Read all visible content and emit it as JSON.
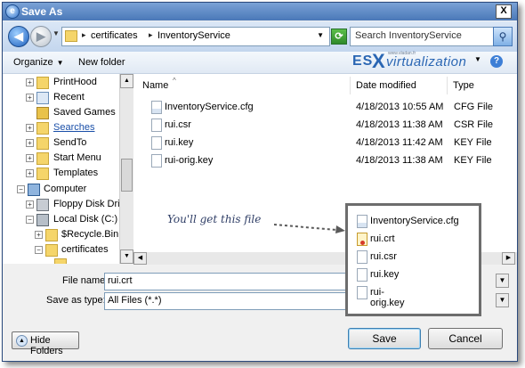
{
  "window": {
    "title": "Save As",
    "close_glyph": "X"
  },
  "nav": {
    "breadcrumbs": [
      "certificates",
      "InventoryService"
    ],
    "search_placeholder": "Search InventoryService"
  },
  "toolbar": {
    "organize_label": "Organize",
    "new_folder_label": "New folder",
    "help_glyph": "?"
  },
  "logo": {
    "es": "ES",
    "x": "X",
    "rest": "virtualization",
    "small": "www.vladan.fr"
  },
  "tree": {
    "items": [
      {
        "label": "PrintHood",
        "expand": "+"
      },
      {
        "label": "Recent",
        "expand": "+"
      },
      {
        "label": "Saved Games",
        "expand": ""
      },
      {
        "label": "Searches",
        "expand": "+"
      },
      {
        "label": "SendTo",
        "expand": "+"
      },
      {
        "label": "Start Menu",
        "expand": "+"
      },
      {
        "label": "Templates",
        "expand": "+"
      },
      {
        "label": "Computer",
        "expand": "−"
      },
      {
        "label": "Floppy Disk Drive",
        "expand": "+"
      },
      {
        "label": "Local Disk (C:)",
        "expand": "−"
      },
      {
        "label": "$Recycle.Bin",
        "expand": "+"
      },
      {
        "label": "certificates",
        "expand": "−"
      }
    ]
  },
  "list": {
    "columns": {
      "name": "Name",
      "date": "Date modified",
      "type": "Type"
    },
    "rows": [
      {
        "name": "InventoryService.cfg",
        "date": "4/18/2013 10:55 AM",
        "type": "CFG File"
      },
      {
        "name": "rui.csr",
        "date": "4/18/2013 11:38 AM",
        "type": "CSR File"
      },
      {
        "name": "rui.key",
        "date": "4/18/2013 11:42 AM",
        "type": "KEY File"
      },
      {
        "name": "rui-orig.key",
        "date": "4/18/2013 11:38 AM",
        "type": "KEY File"
      }
    ]
  },
  "annotation": {
    "text": "You'll get this file",
    "popup_items": [
      "InventoryService.cfg",
      "rui.crt",
      "rui.csr",
      "rui.key",
      "rui-orig.key"
    ]
  },
  "form": {
    "file_name_label": "File name:",
    "file_name_value": "rui.crt",
    "save_as_type_label": "Save as type:",
    "save_as_type_value": "All Files (*.*)"
  },
  "footer": {
    "hide_folders_label": "Hide Folders",
    "save_label": "Save",
    "cancel_label": "Cancel"
  }
}
